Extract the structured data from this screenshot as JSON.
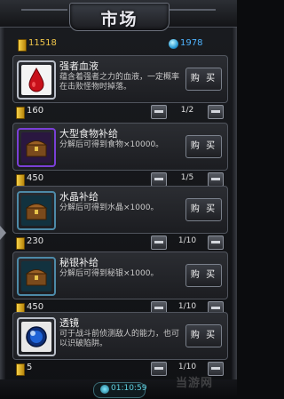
{
  "header": {
    "title": "市场"
  },
  "resources": {
    "gold": "11518",
    "crystal": "1978"
  },
  "items": [
    {
      "name": "强者血液",
      "desc": "蕴含着强者之力的血液，一定概率在击败怪物时掉落。",
      "buy_label": "购 买",
      "price": "160",
      "qty": "1/2",
      "icon": "blood-drop-icon"
    },
    {
      "name": "大型食物补给",
      "desc": "分解后可得到食物×10000。",
      "buy_label": "购 买",
      "price": "450",
      "qty": "1/5",
      "icon": "treasure-chest-icon"
    },
    {
      "name": "水晶补给",
      "desc": "分解后可得到水晶×1000。",
      "buy_label": "购 买",
      "price": "230",
      "qty": "1/10",
      "icon": "treasure-chest-icon"
    },
    {
      "name": "秘银补给",
      "desc": "分解后可得到秘银×1000。",
      "buy_label": "购 买",
      "price": "450",
      "qty": "1/10",
      "icon": "treasure-chest-icon"
    },
    {
      "name": "透镜",
      "desc": "可于战斗前侦测敌人的能力，也可以识破陷阱。",
      "buy_label": "购 买",
      "price": "5",
      "qty": "1/10",
      "icon": "lens-orb-icon"
    }
  ],
  "footer": {
    "clock": "01:10:59",
    "watermark": "当游网"
  },
  "colors": {
    "gold_text": "#f0c64a",
    "crystal_text": "#4fb4ff",
    "blood_red": "#c8101a",
    "purple_frame": "#7a3fd6"
  }
}
